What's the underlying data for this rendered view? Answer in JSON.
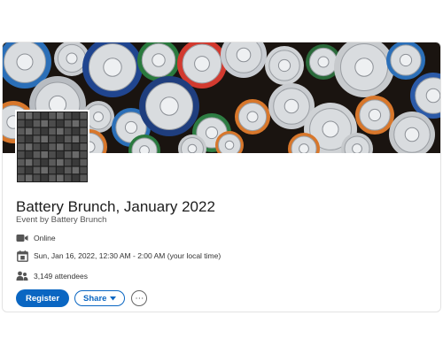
{
  "event": {
    "title": "Battery Brunch, January 2022",
    "byline_prefix": "Event by",
    "organizer": "Battery Brunch",
    "format": "Online",
    "datetime": "Sun, Jan 16, 2022, 12:30 AM - 2:00 AM (your local time)",
    "attendees": "3,149 attendees"
  },
  "actions": {
    "register_label": "Register",
    "share_label": "Share",
    "more_label": "⋯"
  },
  "icons": {
    "format": "video-camera-icon",
    "datetime": "calendar-icon",
    "attendees": "people-icon",
    "share_caret": "caret-down-icon"
  },
  "colors": {
    "accent": "#0a66c2",
    "title": "#1d1d1d",
    "muted": "#555555"
  }
}
